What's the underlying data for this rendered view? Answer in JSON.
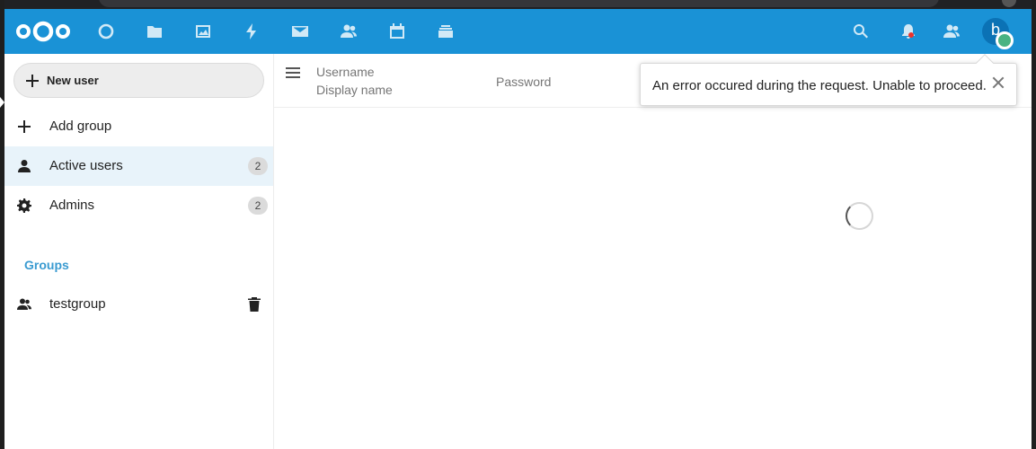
{
  "header": {
    "apps": [
      {
        "name": "Dashboard",
        "icon": "dashboard-icon"
      },
      {
        "name": "Files",
        "icon": "folder-icon"
      },
      {
        "name": "Photos",
        "icon": "image-icon"
      },
      {
        "name": "Activity",
        "icon": "lightning-icon"
      },
      {
        "name": "Mail",
        "icon": "mail-icon"
      },
      {
        "name": "Contacts",
        "icon": "contacts-icon"
      },
      {
        "name": "Calendar",
        "icon": "calendar-icon"
      },
      {
        "name": "Deck",
        "icon": "stack-icon"
      }
    ],
    "avatar_letter": "b",
    "accent": "#1a92d6"
  },
  "sidebar": {
    "new_user_label": "New user",
    "add_group_label": "Add group",
    "active_users_label": "Active users",
    "active_users_count": "2",
    "admins_label": "Admins",
    "admins_count": "2",
    "groups_caption": "Groups",
    "groups": [
      {
        "label": "testgroup"
      }
    ]
  },
  "table": {
    "col_username": "Username",
    "col_displayname": "Display name",
    "col_password": "Password"
  },
  "toast": {
    "message": "An error occured during the request. Unable to proceed."
  }
}
